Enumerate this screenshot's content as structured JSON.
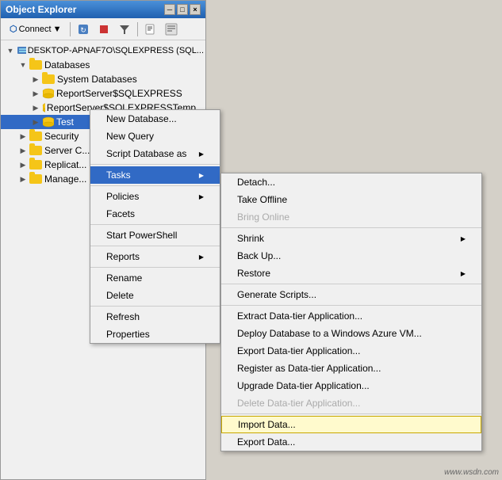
{
  "window": {
    "title": "Object Explorer",
    "titlebar_buttons": [
      "-",
      "□",
      "×"
    ]
  },
  "toolbar": {
    "connect_label": "Connect",
    "connect_arrow": "▼"
  },
  "tree": {
    "server": "DESKTOP-APNAF7O\\SQLEXPRESS (SQL...",
    "items": [
      {
        "label": "Databases",
        "indent": 1,
        "expanded": true
      },
      {
        "label": "System Databases",
        "indent": 2,
        "expanded": false
      },
      {
        "label": "ReportServer$SQLEXPRESS",
        "indent": 2,
        "expanded": false
      },
      {
        "label": "ReportServer$SQLEXPRESSTemp...",
        "indent": 2,
        "expanded": false
      },
      {
        "label": "Test",
        "indent": 2,
        "expanded": false,
        "selected": true
      },
      {
        "label": "Security",
        "indent": 1,
        "expanded": false
      },
      {
        "label": "Server C...",
        "indent": 1,
        "expanded": false
      },
      {
        "label": "Replicat...",
        "indent": 1,
        "expanded": false
      },
      {
        "label": "Manage...",
        "indent": 1,
        "expanded": false
      }
    ]
  },
  "context_menu": {
    "items": [
      {
        "label": "New Database...",
        "type": "item"
      },
      {
        "label": "New Query",
        "type": "item"
      },
      {
        "label": "Script Database as",
        "type": "submenu"
      },
      {
        "label": "Tasks",
        "type": "submenu",
        "active": true
      },
      {
        "label": "Policies",
        "type": "submenu"
      },
      {
        "label": "Facets",
        "type": "item"
      },
      {
        "label": "Start PowerShell",
        "type": "item"
      },
      {
        "label": "Reports",
        "type": "submenu"
      },
      {
        "label": "Rename",
        "type": "item"
      },
      {
        "label": "Delete",
        "type": "item"
      },
      {
        "label": "Refresh",
        "type": "item"
      },
      {
        "label": "Properties",
        "type": "item"
      }
    ]
  },
  "tasks_submenu": {
    "items": [
      {
        "label": "Detach...",
        "type": "item"
      },
      {
        "label": "Take Offline",
        "type": "item"
      },
      {
        "label": "Bring Online",
        "type": "item",
        "disabled": true
      },
      {
        "label": "Shrink",
        "type": "submenu"
      },
      {
        "label": "Back Up...",
        "type": "item"
      },
      {
        "label": "Restore",
        "type": "submenu"
      },
      {
        "label": "Generate Scripts...",
        "type": "item"
      },
      {
        "label": "Extract Data-tier Application...",
        "type": "item"
      },
      {
        "label": "Deploy Database to a Windows Azure VM...",
        "type": "item"
      },
      {
        "label": "Export Data-tier Application...",
        "type": "item"
      },
      {
        "label": "Register as Data-tier Application...",
        "type": "item"
      },
      {
        "label": "Upgrade Data-tier Application...",
        "type": "item"
      },
      {
        "label": "Delete Data-tier Application...",
        "type": "item",
        "disabled": true
      },
      {
        "label": "Import Data...",
        "type": "item",
        "highlighted": true
      },
      {
        "label": "Export Data...",
        "type": "item"
      }
    ]
  },
  "watermark": "www.wsdn.com"
}
